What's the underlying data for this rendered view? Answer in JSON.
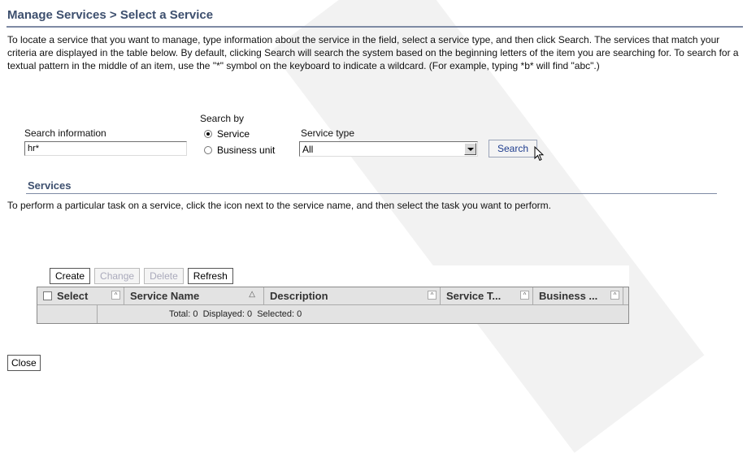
{
  "header": {
    "title": "Manage Services > Select a Service"
  },
  "intro": "To locate a service that you want to manage, type information about the service in the field, select a service type, and then click Search. The services that match your criteria are displayed in the table below. By default, clicking Search will search the system based on the beginning letters of the item you are searching for. To search for a textual pattern in the middle of an item, use the \"*\" symbol on the keyboard to indicate a wildcard. (For example, typing *b* will find \"abc\".)",
  "search": {
    "info_label": "Search information",
    "info_value": "hr*",
    "by_label": "Search by",
    "by_options": [
      "Service",
      "Business unit"
    ],
    "by_selected": "Service",
    "type_label": "Service type",
    "type_value": "All",
    "button_label": "Search"
  },
  "services": {
    "title": "Services",
    "description": "To perform a particular task on a service, click the icon next to the service name, and then select the task you want to perform.",
    "toolbar": {
      "create": "Create",
      "change": "Change",
      "delete": "Delete",
      "refresh": "Refresh"
    },
    "columns": [
      "Select",
      "Service Name",
      "Description",
      "Service T...",
      "Business ..."
    ],
    "footer": "Total: 0  Displayed: 0  Selected: 0"
  },
  "close_label": "Close",
  "colors": {
    "heading": "#3d4f6e",
    "rule": "#7e8aa4",
    "link_text": "#1f3d8e",
    "table_bg": "#e3e3e3"
  }
}
